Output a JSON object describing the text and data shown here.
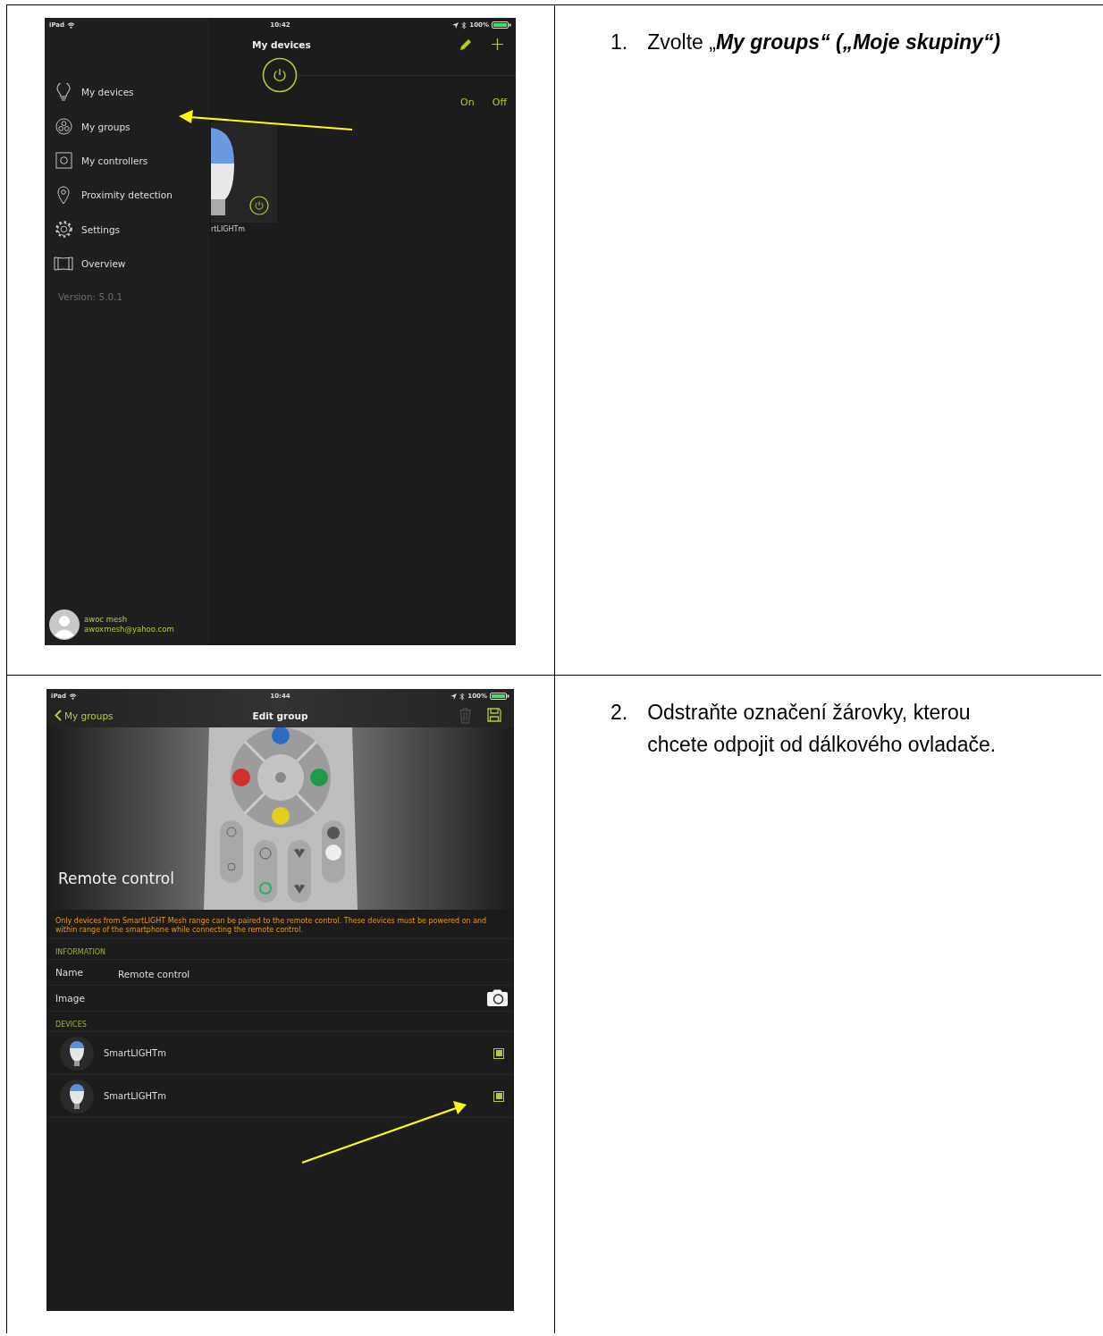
{
  "steps": [
    {
      "number": "1.",
      "instruction": "Zvolte „**My groups“ („Moje skupiny“)**",
      "screen": {
        "kind": "menu",
        "status_bar": {
          "device": "iPad",
          "time": "10:42",
          "battery": "100%"
        },
        "title": "My devices",
        "toggle": [
          "On",
          "Off"
        ],
        "tile_name": "rtLIGHTm",
        "menu": [
          {
            "label": "My devices"
          },
          {
            "label": "My groups"
          },
          {
            "label": "My controllers"
          },
          {
            "label": "Proximity detection"
          },
          {
            "label": "Settings"
          },
          {
            "label": "Overview"
          }
        ],
        "version": "Version: 5.0.1",
        "user": {
          "name": "awoc mesh",
          "email": "awoxmesh@yahoo.com"
        }
      }
    },
    {
      "number": "2.",
      "instruction": "Odstraňte označení žárovky, kterou chcete odpojit od dálkového ovladače.",
      "screen": {
        "kind": "edit_group",
        "status_bar": {
          "device": "iPad",
          "time": "10:44",
          "battery": "100%"
        },
        "back": "My groups",
        "title": "Edit group",
        "hero_title": "Remote control",
        "notice": "Only devices from SmartLIGHT Mesh range can be paired to the remote control. These devices must be powered on and within range of the smartphone while connecting the remote control.",
        "information": {
          "heading": "INFORMATION",
          "rows": [
            {
              "label": "Name",
              "value": "Remote control"
            },
            {
              "label": "Image"
            }
          ]
        },
        "devices": {
          "heading": "DEVICES",
          "items": [
            {
              "name": "SmartLIGHTm",
              "checked": true
            },
            {
              "name": "SmartLIGHTm",
              "checked": true
            }
          ]
        }
      }
    }
  ]
}
